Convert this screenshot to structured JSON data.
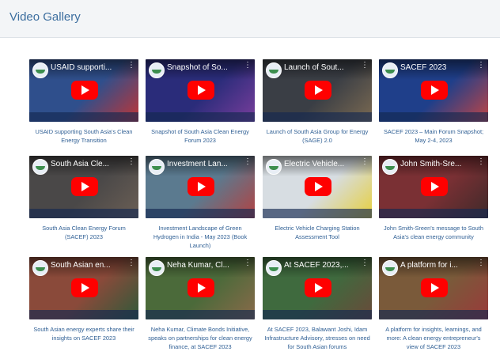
{
  "header": {
    "title": "Video Gallery"
  },
  "icons": {
    "play": "play-button-icon",
    "menu": "more-vert-icon",
    "channel": "channel-logo-icon"
  },
  "colors": {
    "accent": "#3c6e9f",
    "play": "#ff0000"
  },
  "videos": [
    {
      "thumb_title": "USAID supporti...",
      "caption": "USAID supporting South Asia's Clean Energy Transition",
      "bg": "#2f4f8c",
      "bg2": "#c13535"
    },
    {
      "thumb_title": "Snapshot of So...",
      "caption": "Snapshot of South Asia Clean Energy Forum 2023",
      "bg": "#2a2c7a",
      "bg2": "#7a3e9c"
    },
    {
      "thumb_title": "Launch of Sout...",
      "caption": "Launch of South Asia Group for Energy (SAGE) 2.0",
      "bg": "#3a3e45",
      "bg2": "#7b6a52"
    },
    {
      "thumb_title": "SACEF 2023",
      "caption": "SACEF 2023 – Main Forum Snapshot; May 2-4, 2023",
      "bg": "#1f3f8a",
      "bg2": "#c24545"
    },
    {
      "thumb_title": "South Asia Cle...",
      "caption": "South Asia Clean Energy Forum (SACEF) 2023",
      "bg": "#4a4848",
      "bg2": "#6b5f55"
    },
    {
      "thumb_title": "Investment Lan...",
      "caption": "Investment Landscape of Green Hydrogen in India - May 2023 (Book Launch)",
      "bg": "#5b7a8f",
      "bg2": "#b34242"
    },
    {
      "thumb_title": "Electric Vehicle...",
      "caption": "Electric Vehicle Charging Station Assessment Tool",
      "bg": "#d7dde2",
      "bg2": "#e6cf3c"
    },
    {
      "thumb_title": "John Smith-Sre...",
      "caption": "John Smith-Sreen's message to South Asia's clean energy community",
      "bg": "#7a3034",
      "bg2": "#3f2a2a"
    },
    {
      "thumb_title": "South Asian en...",
      "caption": "South Asian energy experts share their insights on SACEF 2023",
      "bg": "#8a4a3a",
      "bg2": "#2f5a3a"
    },
    {
      "thumb_title": "Neha Kumar, Cl...",
      "caption": "Neha Kumar, Climate Bonds Initiative, speaks on partnerships for clean energy finance, at SACEF 2023",
      "bg": "#4b6a3a",
      "bg2": "#8a6a4a"
    },
    {
      "thumb_title": "At SACEF 2023,...",
      "caption": "At SACEF 2023, Balawant Joshi, Idam Infrastructure Advisory, stresses on need for South Asian forums",
      "bg": "#3f6a3e",
      "bg2": "#6a4a3a"
    },
    {
      "thumb_title": "A platform for i...",
      "caption": "A platform for insights, learnings, and more: A clean energy entrepreneur's view of SACEF 2023",
      "bg": "#7a5a3a",
      "bg2": "#9a3a3a"
    }
  ]
}
